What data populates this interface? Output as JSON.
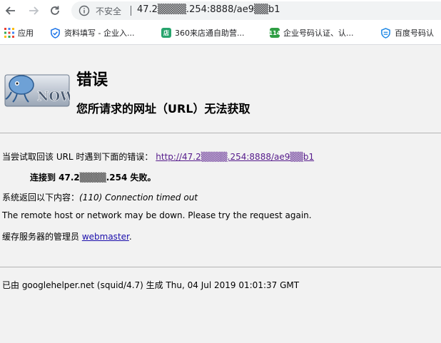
{
  "browser": {
    "insecure_label": "不安全",
    "url": "47.2▒▒▒▒.254:8888/ae9▒▒b1"
  },
  "bookmarks": [
    {
      "label": "应用",
      "icon": "apps-grid-icon"
    },
    {
      "label": "资料填写 - 企业入...",
      "icon": "shield-check-icon"
    },
    {
      "label": "360来店通自助营...",
      "icon": "green-square-icon"
    },
    {
      "label": "企业号码认证、认...",
      "icon": "number-114-icon"
    },
    {
      "label": "百度号码认",
      "icon": "baidu-shield-icon"
    }
  ],
  "error": {
    "title": "错误",
    "subtitle": "您所请求的网址（URL）无法获取",
    "attempt_prefix": "当尝试取回该 URL 时遇到下面的错误：",
    "attempt_url": "http://47.2▒▒▒▒.254:8888/ae9▒▒b1",
    "connect_fail": "连接到 47.2▒▒▒▒.254 失败。",
    "system_prefix": "系统返回以下内容：",
    "system_msg": "(110) Connection timed out",
    "remote_msg": "The remote host or network may be down. Please try the request again.",
    "admin_prefix": "缓存服务器的管理员 ",
    "admin_link": "webmaster",
    "admin_suffix": "."
  },
  "footer": {
    "text": "已由 googlehelper.net (squid/4.7) 生成 Thu, 04 Jul 2019 01:01:37 GMT"
  },
  "colors": {
    "visited_link": "#551a8b",
    "link": "#1a0dab",
    "page_bg": "#f2f2f2"
  }
}
